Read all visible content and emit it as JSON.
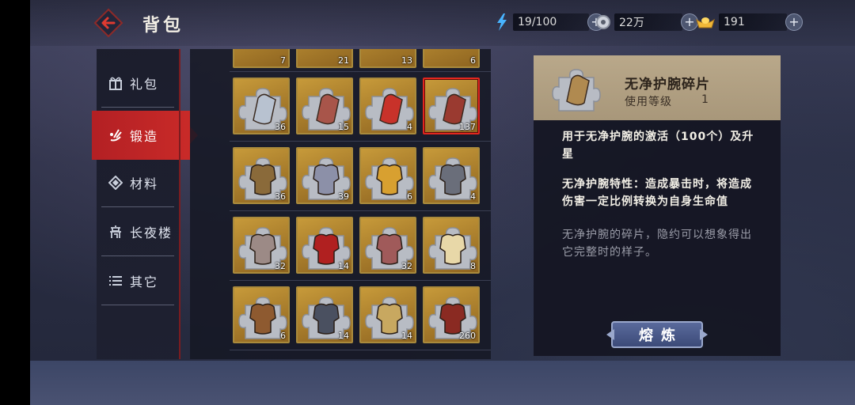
{
  "header": {
    "title": "背包",
    "stamina": "19/100",
    "coins": "22万",
    "gold": "191",
    "plus": "+"
  },
  "sidebar": {
    "items": [
      {
        "label": "礼包",
        "icon": "gift-icon"
      },
      {
        "label": "锻造",
        "icon": "forge-icon",
        "active": true
      },
      {
        "label": "材料",
        "icon": "material-icon"
      },
      {
        "label": "长夜楼",
        "icon": "tower-icon"
      },
      {
        "label": "其它",
        "icon": "list-icon"
      }
    ]
  },
  "grid": {
    "partial_row": [
      "7",
      "21",
      "13",
      "6"
    ],
    "rows": [
      [
        {
          "qty": "36",
          "kind": "bracer"
        },
        {
          "qty": "15",
          "kind": "bracer"
        },
        {
          "qty": "4",
          "kind": "bracer"
        },
        {
          "qty": "137",
          "kind": "bracer",
          "selected": true
        }
      ],
      [
        {
          "qty": "36",
          "kind": "armor"
        },
        {
          "qty": "39",
          "kind": "armor"
        },
        {
          "qty": "6",
          "kind": "armor"
        },
        {
          "qty": "4",
          "kind": "armor"
        }
      ],
      [
        {
          "qty": "32",
          "kind": "armor"
        },
        {
          "qty": "14",
          "kind": "armor"
        },
        {
          "qty": "32",
          "kind": "armor"
        },
        {
          "qty": "8",
          "kind": "armor"
        }
      ],
      [
        {
          "qty": "6",
          "kind": "armor"
        },
        {
          "qty": "14",
          "kind": "armor"
        },
        {
          "qty": "14",
          "kind": "armor"
        },
        {
          "qty": "260",
          "kind": "armor"
        }
      ]
    ]
  },
  "detail": {
    "name": "无净护腕碎片",
    "level_label": "使用等级",
    "level_value": "1",
    "desc_line1": "用于无净护腕的激活（100个）及升星",
    "desc_line2": "无净护腕特性：造成暴击时，将造成伤害一定比例转换为自身生命值",
    "flavor": "无净护腕的碎片，隐约可以想象得出它完整时的样子。",
    "button": "熔炼"
  },
  "colors": {
    "accent_red": "#c92a28",
    "slot_gold": "#c79a3a",
    "button_blue": "#4a5a8c"
  }
}
